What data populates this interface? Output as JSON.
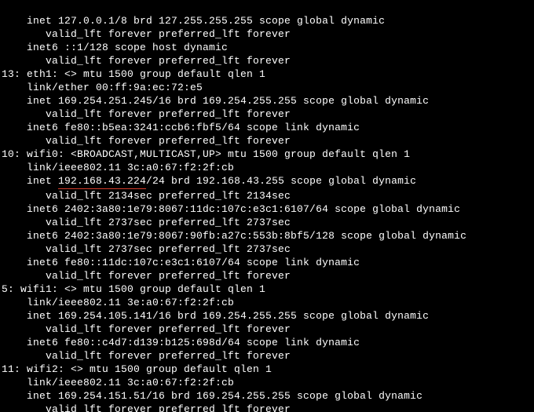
{
  "l": {
    "l1": "    inet 127.0.0.1/8 brd 127.255.255.255 scope global dynamic",
    "l2": "       valid_lft forever preferred_lft forever",
    "l3": "    inet6 ::1/128 scope host dynamic",
    "l4": "       valid_lft forever preferred_lft forever",
    "l5": "13: eth1: <> mtu 1500 group default qlen 1",
    "l6": "    link/ether 00:ff:9a:ec:72:e5",
    "l7": "    inet 169.254.251.245/16 brd 169.254.255.255 scope global dynamic",
    "l8": "       valid_lft forever preferred_lft forever",
    "l9": "    inet6 fe80::b5ea:3241:ccb6:fbf5/64 scope link dynamic",
    "l10": "       valid_lft forever preferred_lft forever",
    "l11": "10: wifi0: <BROADCAST,MULTICAST,UP> mtu 1500 group default qlen 1",
    "l12": "    link/ieee802.11 3c:a0:67:f2:2f:cb",
    "l13a": "    inet ",
    "l13u": "192.168.43.224",
    "l13b": "/24 brd 192.168.43.255 scope global dynamic",
    "l14": "       valid_lft 2134sec preferred_lft 2134sec",
    "l15": "    inet6 2402:3a80:1e79:8067:11dc:107c:e3c1:6107/64 scope global dynamic",
    "l16": "       valid_lft 2737sec preferred_lft 2737sec",
    "l17": "    inet6 2402:3a80:1e79:8067:90fb:a27c:553b:8bf5/128 scope global dynamic",
    "l18": "       valid_lft 2737sec preferred_lft 2737sec",
    "l19": "    inet6 fe80::11dc:107c:e3c1:6107/64 scope link dynamic",
    "l20": "       valid_lft forever preferred_lft forever",
    "l21": "5: wifi1: <> mtu 1500 group default qlen 1",
    "l22": "    link/ieee802.11 3e:a0:67:f2:2f:cb",
    "l23": "    inet 169.254.105.141/16 brd 169.254.255.255 scope global dynamic",
    "l24": "       valid_lft forever preferred_lft forever",
    "l25": "    inet6 fe80::c4d7:d139:b125:698d/64 scope link dynamic",
    "l26": "       valid_lft forever preferred_lft forever",
    "l27": "11: wifi2: <> mtu 1500 group default qlen 1",
    "l28": "    link/ieee802.11 3c:a0:67:f2:2f:cb",
    "l29": "    inet 169.254.151.51/16 brd 169.254.255.255 scope global dynamic",
    "l30": "       valid_lft forever preferred_lft forever"
  }
}
